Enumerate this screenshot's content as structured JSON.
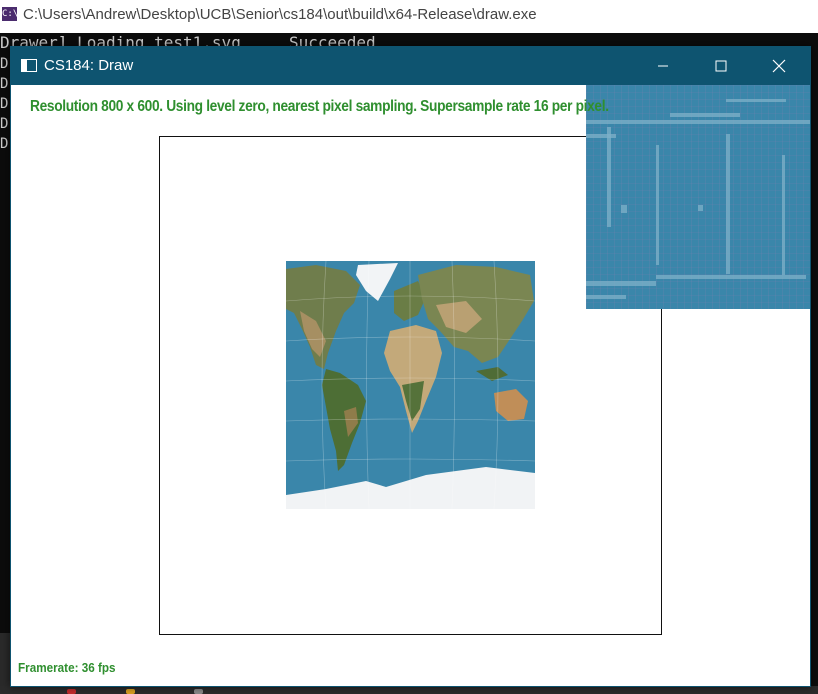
{
  "console": {
    "title": "C:\\Users\\Andrew\\Desktop\\UCB\\Senior\\cs184\\out\\build\\x64-Release\\draw.exe",
    "icon_label": "C:\\",
    "first_line": "Drawer] Loading test1.svg     Succeeded",
    "line_prefix": "D"
  },
  "app": {
    "title": "CS184: Draw",
    "status_text": "Resolution 800 x 600. Using level zero, nearest pixel sampling. Supersample rate 16 per pixel.",
    "framerate_text": "Framerate: 36 fps",
    "window_buttons": [
      "minimize-icon",
      "maximize-icon",
      "close-icon"
    ]
  },
  "colors": {
    "title_bar": "#0e5470",
    "status_green": "#2f8f2f",
    "canvas_bg": "#ffffff",
    "ocean_blue": "#3a86aa",
    "console_bg": "#0c0c0c"
  }
}
